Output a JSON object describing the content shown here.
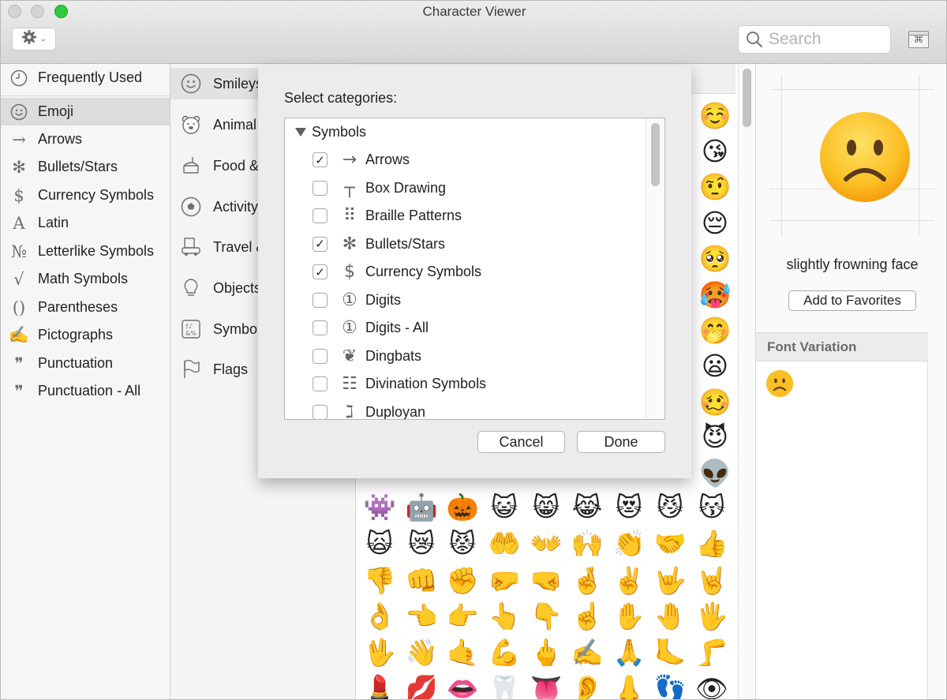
{
  "window": {
    "title": "Character Viewer"
  },
  "toolbar": {
    "action_icon": "gear-icon",
    "search_placeholder": "Search",
    "keyboard_icon": "keyboard-viewer-icon"
  },
  "sidebar": {
    "items": [
      {
        "label": "Frequently Used",
        "icon": "clock-icon",
        "glyph": ""
      },
      {
        "label": "Emoji",
        "icon": "smiley-icon",
        "glyph": "",
        "selected": true
      },
      {
        "label": "Arrows",
        "icon": "arrow-icon",
        "glyph": "→"
      },
      {
        "label": "Bullets/Stars",
        "icon": "asterisk-icon",
        "glyph": "✻"
      },
      {
        "label": "Currency Symbols",
        "icon": "dollar-icon",
        "glyph": "$"
      },
      {
        "label": "Latin",
        "icon": "latin-a-icon",
        "glyph": "A"
      },
      {
        "label": "Letterlike Symbols",
        "icon": "numero-icon",
        "glyph": "№"
      },
      {
        "label": "Math Symbols",
        "icon": "sqrt-icon",
        "glyph": "√"
      },
      {
        "label": "Parentheses",
        "icon": "parentheses-icon",
        "glyph": "()"
      },
      {
        "label": "Pictographs",
        "icon": "pencil-icon",
        "glyph": "✍"
      },
      {
        "label": "Punctuation",
        "icon": "quote-icon",
        "glyph": "❞"
      },
      {
        "label": "Punctuation - All",
        "icon": "quote-all-icon",
        "glyph": "❞"
      }
    ]
  },
  "categories": {
    "items": [
      {
        "label": "Smileys",
        "icon": "smiley-icon",
        "selected": true
      },
      {
        "label": "Animal",
        "icon": "bear-icon"
      },
      {
        "label": "Food &",
        "icon": "food-icon"
      },
      {
        "label": "Activity",
        "icon": "soccer-ball-icon"
      },
      {
        "label": "Travel &",
        "icon": "car-building-icon"
      },
      {
        "label": "Objects",
        "icon": "lightbulb-icon"
      },
      {
        "label": "Symbo",
        "icon": "symbols-icon"
      },
      {
        "label": "Flags",
        "icon": "flag-icon"
      }
    ]
  },
  "emoji_grid": {
    "right_column": [
      "☺️",
      "😘",
      "🤨",
      "😔",
      "🥺",
      "🥵",
      "🤭",
      "😦",
      "🥴",
      "😈",
      "👽"
    ],
    "rows": [
      [
        "👾",
        "🤖",
        "🎃",
        "😺",
        "😸",
        "😹",
        "😻",
        "😼",
        "😽"
      ],
      [
        "🙀",
        "😿",
        "😾",
        "🤲",
        "👐",
        "🙌",
        "👏",
        "🤝",
        "👍"
      ],
      [
        "👎",
        "👊",
        "✊",
        "🤛",
        "🤜",
        "🤞",
        "✌️",
        "🤟",
        "🤘"
      ],
      [
        "👌",
        "👈",
        "👉",
        "👆",
        "👇",
        "☝️",
        "✋",
        "🤚",
        "🖐"
      ],
      [
        "🖖",
        "👋",
        "🤙",
        "💪",
        "🖕",
        "✍️",
        "🙏",
        "🦶",
        "🦵"
      ],
      [
        "💄",
        "💋",
        "👄",
        "🦷",
        "👅",
        "👂",
        "👃",
        "👣",
        "👁"
      ]
    ]
  },
  "detail": {
    "character_name": "slightly frowning face",
    "add_favorites_label": "Add to Favorites",
    "font_variation_header": "Font Variation"
  },
  "sheet": {
    "title": "Select categories:",
    "group_label": "Symbols",
    "rows": [
      {
        "label": "Arrows",
        "checked": true,
        "icon": "arrow-icon",
        "glyph": "→"
      },
      {
        "label": "Box Drawing",
        "checked": false,
        "icon": "box-drawing-icon",
        "glyph": "┬"
      },
      {
        "label": "Braille Patterns",
        "checked": false,
        "icon": "braille-icon",
        "glyph": "⠿"
      },
      {
        "label": "Bullets/Stars",
        "checked": true,
        "icon": "asterisk-icon",
        "glyph": "✻"
      },
      {
        "label": "Currency Symbols",
        "checked": true,
        "icon": "dollar-icon",
        "glyph": "$"
      },
      {
        "label": "Digits",
        "checked": false,
        "icon": "circled-one-icon",
        "glyph": "①"
      },
      {
        "label": "Digits - All",
        "checked": false,
        "icon": "circled-one-icon",
        "glyph": "①"
      },
      {
        "label": "Dingbats",
        "checked": false,
        "icon": "heart-dingbat-icon",
        "glyph": "❦"
      },
      {
        "label": "Divination Symbols",
        "checked": false,
        "icon": "trigram-icon",
        "glyph": "☷"
      },
      {
        "label": "Duployan",
        "checked": false,
        "icon": "duployan-icon",
        "glyph": "ℷ"
      }
    ],
    "cancel_label": "Cancel",
    "done_label": "Done"
  },
  "colors": {
    "accent_green": "#2fc840",
    "selection_gray": "#dcdcdc",
    "sheet_bg": "#ececec"
  }
}
